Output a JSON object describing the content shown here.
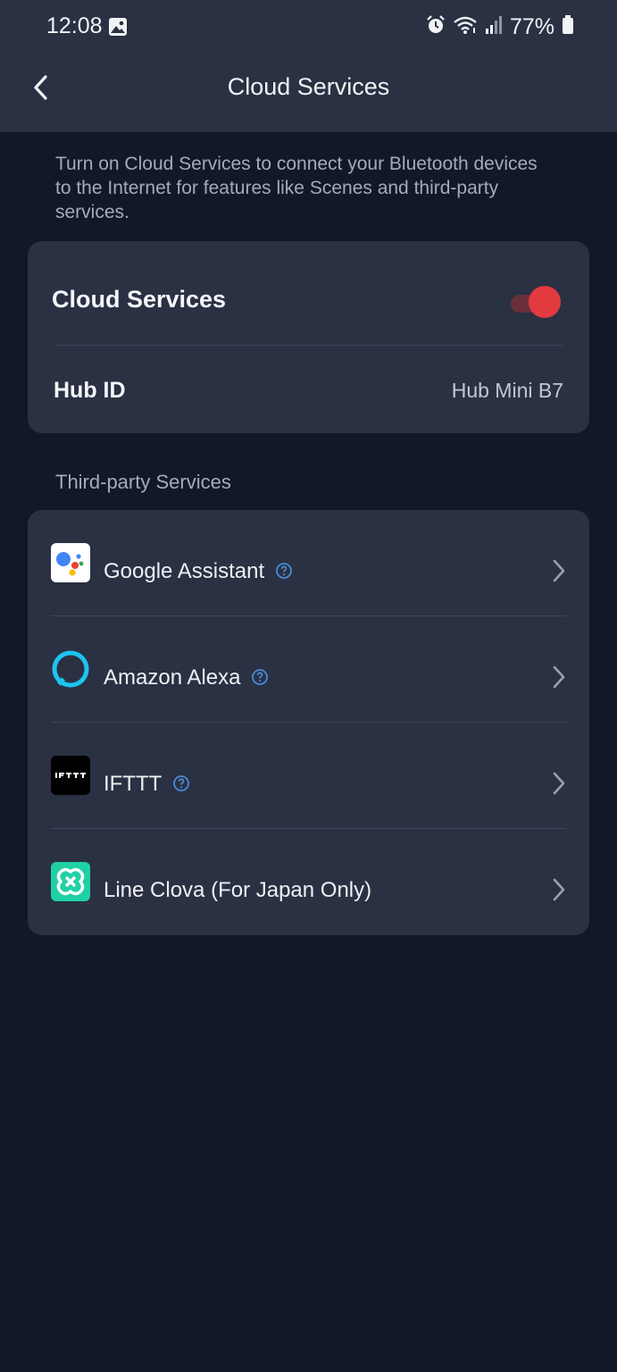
{
  "status_bar": {
    "time": "12:08",
    "battery": "77%",
    "icons": [
      "gallery-icon",
      "alarm-icon",
      "wifi-icon",
      "signal-icon",
      "battery-icon"
    ]
  },
  "header": {
    "title": "Cloud Services",
    "back_icon": "chevron-left-icon"
  },
  "description": "Turn on Cloud Services to connect your Bluetooth devices to the Internet for features like Scenes and third-party services.",
  "cloud_card": {
    "cloud_services_label": "Cloud Services",
    "cloud_services_enabled": true,
    "hub_id_label": "Hub ID",
    "hub_id_value": "Hub Mini B7"
  },
  "third_party": {
    "section_label": "Third-party Services",
    "items": [
      {
        "name": "Google Assistant",
        "icon": "google-assistant-icon",
        "has_help": true
      },
      {
        "name": "Amazon Alexa",
        "icon": "amazon-alexa-icon",
        "has_help": true
      },
      {
        "name": "IFTTT",
        "icon": "ifttt-icon",
        "has_help": true
      },
      {
        "name": "Line Clova (For Japan Only)",
        "icon": "line-clova-icon",
        "has_help": false
      }
    ]
  },
  "colors": {
    "background": "#121827",
    "card": "#2a3143",
    "toggle_on": "#e23a3f",
    "help_icon": "#4a8bd8"
  }
}
